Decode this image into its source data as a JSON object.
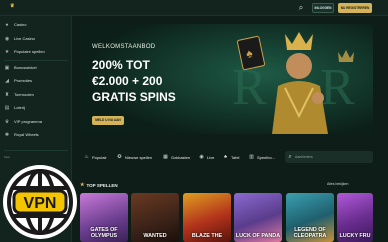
{
  "brand": {
    "name": "ROYAL\nWHEELS"
  },
  "header": {
    "login_label": "INLOGGEN",
    "register_label": "NU REGISTREREN"
  },
  "sidebar": {
    "items": [
      {
        "label": "Casino",
        "icon": "cards-icon"
      },
      {
        "label": "Live Casino",
        "icon": "live-icon"
      },
      {
        "label": "Populaire spellen",
        "icon": "star-icon"
      },
      {
        "label": "Bonuswinkel",
        "icon": "gift-icon"
      },
      {
        "label": "Promoties",
        "icon": "megaphone-icon"
      },
      {
        "label": "Toernooien",
        "icon": "trophy-icon"
      },
      {
        "label": "Loterij",
        "icon": "ticket-icon"
      },
      {
        "label": "VIP programma",
        "icon": "crown-icon"
      },
      {
        "label": "Royal Wheels",
        "icon": "wheel-icon"
      }
    ],
    "footer_label": "Taal"
  },
  "hero": {
    "kicker": "WELKOMSTAANBOD",
    "lines": [
      "200% TOT",
      "€2.000 + 200",
      "GRATIS SPINS"
    ],
    "cta_label": "MELD U NU AAN"
  },
  "categories": [
    {
      "label": "Populair",
      "icon": "fire-icon"
    },
    {
      "label": "Nieuwe spellen",
      "icon": "new-icon"
    },
    {
      "label": "Gokkasten",
      "icon": "slot-icon"
    },
    {
      "label": "Live",
      "icon": "live-icon"
    },
    {
      "label": "Tafel",
      "icon": "table-icon"
    },
    {
      "label": "Speelbo...",
      "icon": "providers-icon"
    }
  ],
  "search": {
    "placeholder": "Aanbieders"
  },
  "top_games": {
    "title": "TOP SPELLEN",
    "view_all_label": "Alles bekijken",
    "games": [
      {
        "title": "GATES OF OLYMPUS",
        "color": "#7b4a9e"
      },
      {
        "title": "WANTED",
        "color": "#3b2218"
      },
      {
        "title": "BLAZE THE",
        "color": "#9a2a1a"
      },
      {
        "title": "LUCK OF PANDA",
        "color": "#5a3c8c"
      },
      {
        "title": "LEGEND OF CLEOPATRA",
        "color": "#1f5f6e"
      },
      {
        "title": "LUCKY FRU",
        "color": "#6a2d8f"
      }
    ]
  },
  "overlay": {
    "vpn_label": "VPN"
  }
}
